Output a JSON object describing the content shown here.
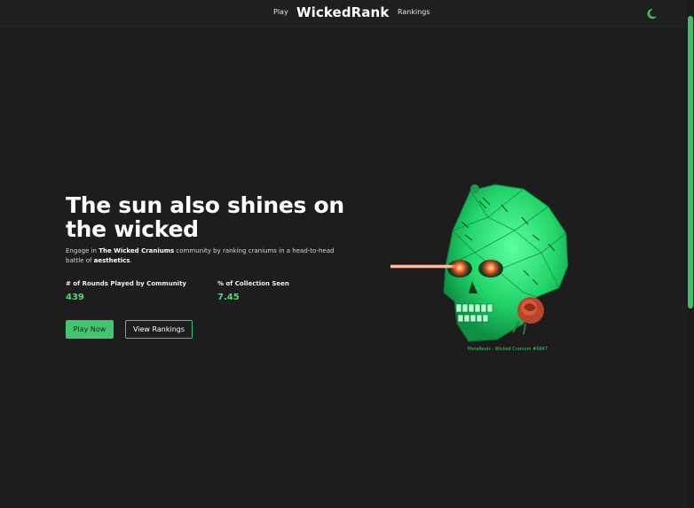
{
  "nav": {
    "play": "Play",
    "brand": "WickedRank",
    "rankings": "Rankings",
    "theme_icon": "moon-icon"
  },
  "hero": {
    "title": "The sun also shines on the wicked",
    "desc_prefix": "Engage in ",
    "desc_bold": "The Wicked Craniums",
    "desc_mid": " community by ranking craniums in a head-to-head battle of ",
    "desc_bold2": "aesthetics",
    "desc_end": "."
  },
  "stats": [
    {
      "label": "# of Rounds Played by Community",
      "value": "439"
    },
    {
      "label": "% of Collection Seen",
      "value": "7.45"
    }
  ],
  "buttons": {
    "primary": "Play Now",
    "secondary": "View Rankings"
  },
  "artwork": {
    "caption": "MetaReals - Wicked Cranium #9847",
    "icon": "skull-artwork"
  },
  "colors": {
    "background": "#1d1d1d",
    "accent": "#43c46e",
    "text": "#ffffff"
  }
}
